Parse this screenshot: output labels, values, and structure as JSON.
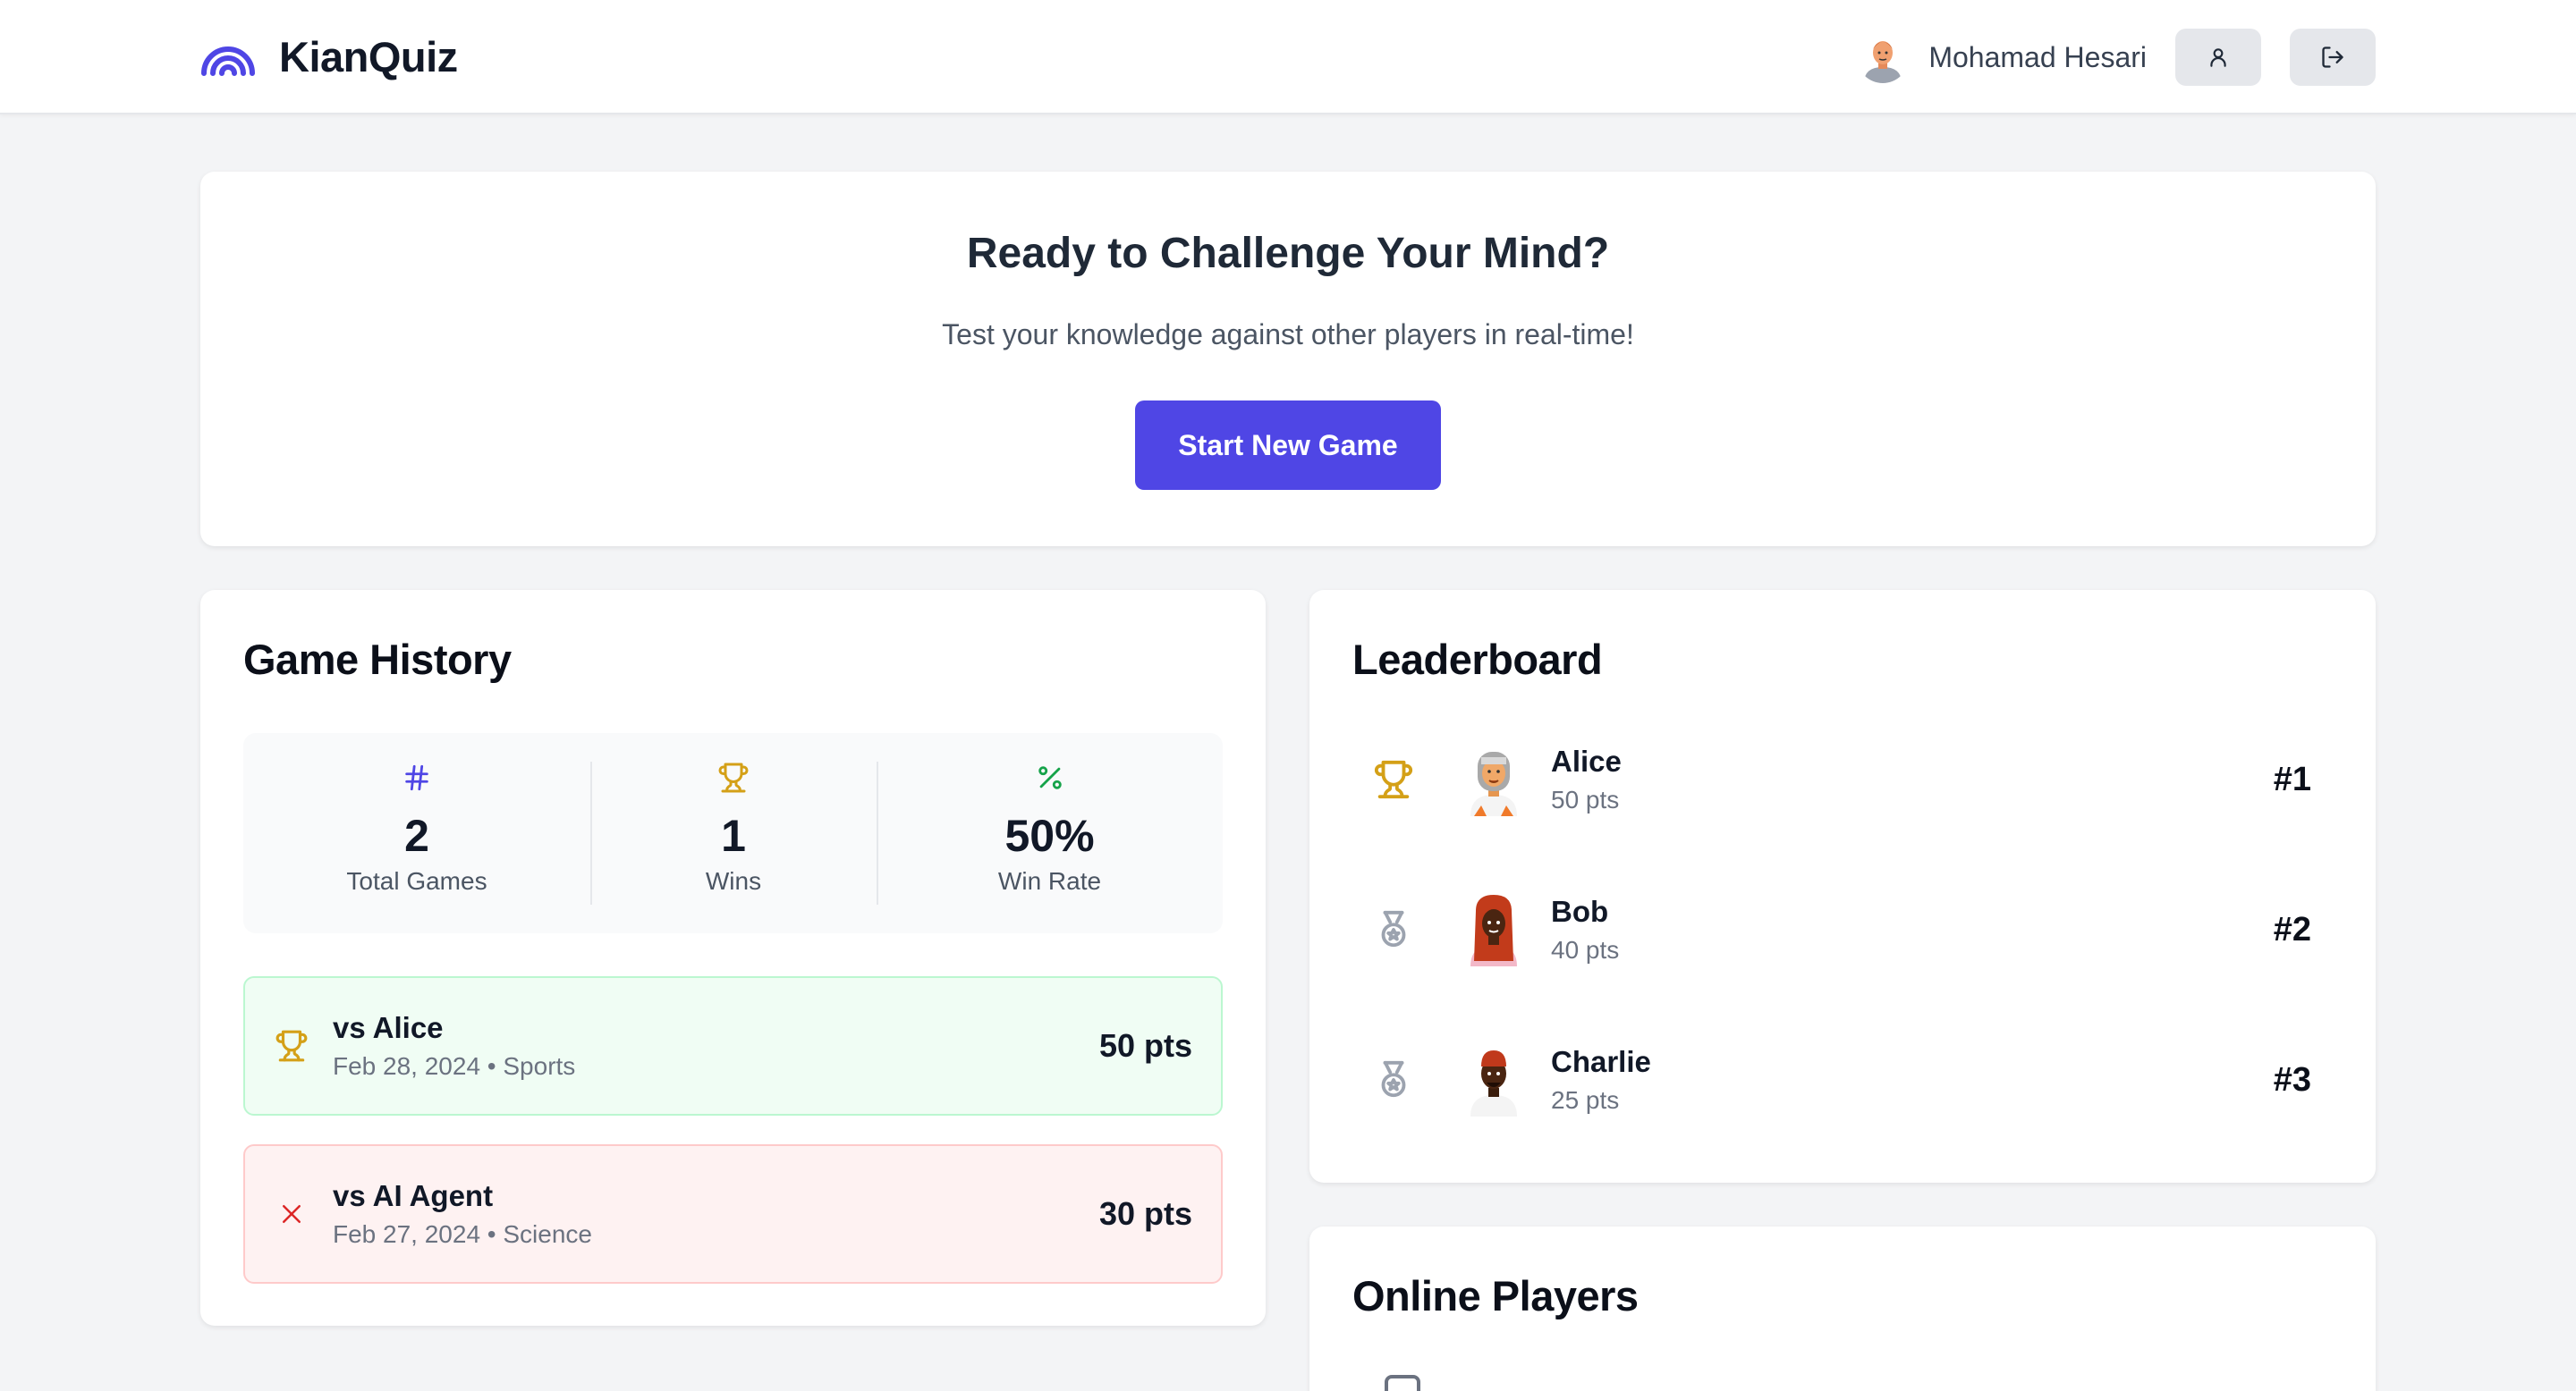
{
  "header": {
    "brand_name": "KianQuiz",
    "user_name": "Mohamad Hesari",
    "profile_button_icon": "user-icon",
    "logout_button_icon": "logout-icon"
  },
  "hero": {
    "title": "Ready to Challenge Your Mind?",
    "subtitle": "Test your knowledge against other players in real-time!",
    "cta_label": "Start New Game"
  },
  "history": {
    "title": "Game History",
    "stats": [
      {
        "icon": "hash-icon",
        "value": "2",
        "label": "Total Games"
      },
      {
        "icon": "trophy-icon",
        "value": "1",
        "label": "Wins"
      },
      {
        "icon": "percent-icon",
        "value": "50%",
        "label": "Win Rate"
      }
    ],
    "games": [
      {
        "result": "win",
        "icon": "trophy-icon",
        "opponent": "vs Alice",
        "meta": "Feb 28, 2024 • Sports",
        "points": "50 pts"
      },
      {
        "result": "loss",
        "icon": "close-icon",
        "opponent": "vs AI Agent",
        "meta": "Feb 27, 2024 • Science",
        "points": "30 pts"
      }
    ]
  },
  "leaderboard": {
    "title": "Leaderboard",
    "players": [
      {
        "medal": "trophy-icon",
        "name": "Alice",
        "points": "50 pts",
        "rank": "#1"
      },
      {
        "medal": "medal-icon",
        "name": "Bob",
        "points": "40 pts",
        "rank": "#2"
      },
      {
        "medal": "medal-icon",
        "name": "Charlie",
        "points": "25 pts",
        "rank": "#3"
      }
    ]
  },
  "online": {
    "title": "Online Players"
  },
  "colors": {
    "accent": "#4f46e5",
    "gold": "#d4a017",
    "success": "#16a34a",
    "danger": "#dc2626",
    "silver": "#9ca3af"
  }
}
